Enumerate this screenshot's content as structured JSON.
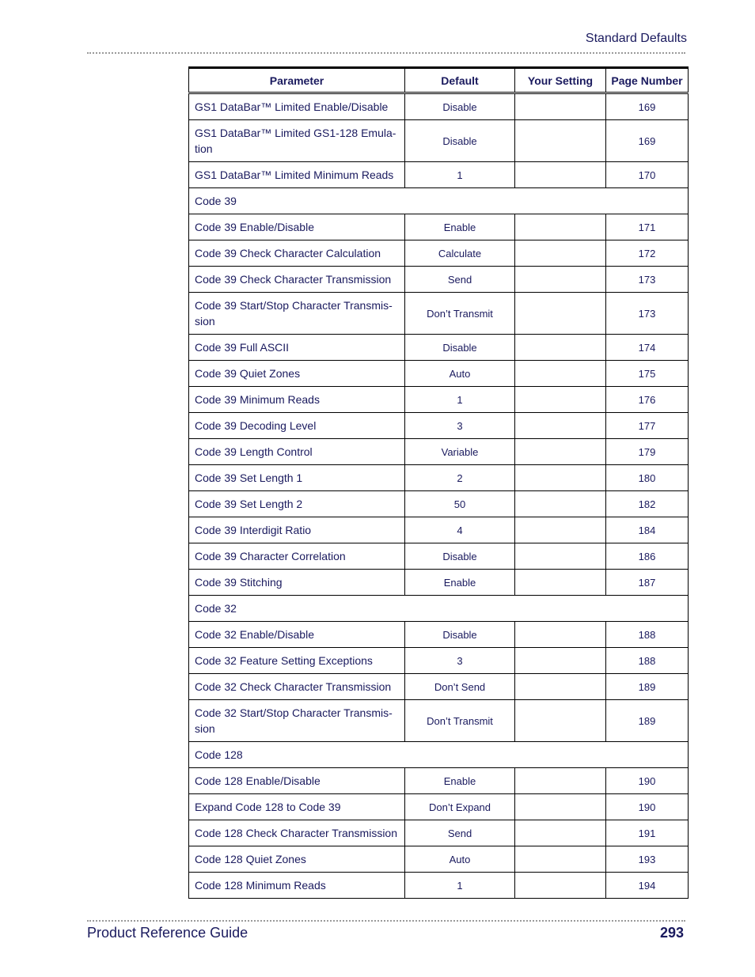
{
  "header": {
    "title": "Standard Defaults"
  },
  "table": {
    "columns": [
      "Parameter",
      "Default",
      "Your Setting",
      "Page Number"
    ],
    "rows": [
      {
        "type": "param",
        "parameter": "GS1 DataBar™ Limited Enable/Disable",
        "default": "Disable",
        "setting": "",
        "page": "169"
      },
      {
        "type": "param",
        "parameter": "GS1 DataBar™ Limited GS1-128 Emula-tion",
        "default": "Disable",
        "setting": "",
        "page": "169",
        "two_line": true
      },
      {
        "type": "param",
        "parameter": "GS1 DataBar™ Limited Minimum Reads",
        "default": "1",
        "setting": "",
        "page": "170"
      },
      {
        "type": "section",
        "parameter": "Code 39"
      },
      {
        "type": "param",
        "parameter": "Code 39 Enable/Disable",
        "default": "Enable",
        "setting": "",
        "page": "171"
      },
      {
        "type": "param",
        "parameter": "Code 39 Check Character Calculation",
        "default": "Calculate",
        "setting": "",
        "page": "172"
      },
      {
        "type": "param",
        "parameter": "Code 39 Check Character Transmission",
        "default": "Send",
        "setting": "",
        "page": "173"
      },
      {
        "type": "param",
        "parameter": "Code 39 Start/Stop Character Transmis-sion",
        "default": "Don’t Transmit",
        "setting": "",
        "page": "173",
        "two_line": true
      },
      {
        "type": "param",
        "parameter": "Code 39 Full ASCII",
        "default": "Disable",
        "setting": "",
        "page": "174"
      },
      {
        "type": "param",
        "parameter": "Code 39 Quiet Zones",
        "default": "Auto",
        "setting": "",
        "page": "175"
      },
      {
        "type": "param",
        "parameter": "Code 39 Minimum Reads",
        "default": "1",
        "setting": "",
        "page": "176"
      },
      {
        "type": "param",
        "parameter": "Code 39 Decoding Level",
        "default": "3",
        "setting": "",
        "page": "177"
      },
      {
        "type": "param",
        "parameter": "Code 39 Length Control",
        "default": "Variable",
        "setting": "",
        "page": "179"
      },
      {
        "type": "param",
        "parameter": "Code 39 Set Length 1",
        "default": "2",
        "setting": "",
        "page": "180"
      },
      {
        "type": "param",
        "parameter": "Code 39 Set Length 2",
        "default": "50",
        "setting": "",
        "page": "182"
      },
      {
        "type": "param",
        "parameter": "Code 39 Interdigit Ratio",
        "default": "4",
        "setting": "",
        "page": "184"
      },
      {
        "type": "param",
        "parameter": "Code 39 Character Correlation",
        "default": "Disable",
        "setting": "",
        "page": "186"
      },
      {
        "type": "param",
        "parameter": "Code 39 Stitching",
        "default": "Enable",
        "setting": "",
        "page": "187"
      },
      {
        "type": "section",
        "parameter": "Code 32"
      },
      {
        "type": "param",
        "parameter": "Code 32 Enable/Disable",
        "default": "Disable",
        "setting": "",
        "page": "188"
      },
      {
        "type": "param",
        "parameter": "Code 32 Feature Setting Exceptions",
        "default": "3",
        "setting": "",
        "page": "188"
      },
      {
        "type": "param",
        "parameter": "Code 32 Check Character Transmission",
        "default": "Don’t Send",
        "setting": "",
        "page": "189"
      },
      {
        "type": "param",
        "parameter": "Code 32 Start/Stop Character Transmis-sion",
        "default": "Don’t Transmit",
        "setting": "",
        "page": "189",
        "two_line": true
      },
      {
        "type": "section",
        "parameter": "Code 128"
      },
      {
        "type": "param",
        "parameter": "Code 128 Enable/Disable",
        "default": "Enable",
        "setting": "",
        "page": "190"
      },
      {
        "type": "param",
        "parameter": "Expand Code 128 to Code 39",
        "default": "Don’t Expand",
        "setting": "",
        "page": "190"
      },
      {
        "type": "param",
        "parameter": "Code 128 Check Character Transmission",
        "default": "Send",
        "setting": "",
        "page": "191"
      },
      {
        "type": "param",
        "parameter": "Code 128 Quiet Zones",
        "default": "Auto",
        "setting": "",
        "page": "193"
      },
      {
        "type": "param",
        "parameter": "Code 128 Minimum Reads",
        "default": "1",
        "setting": "",
        "page": "194"
      }
    ]
  },
  "footer": {
    "guide_title": "Product Reference Guide",
    "page_number": "293"
  }
}
